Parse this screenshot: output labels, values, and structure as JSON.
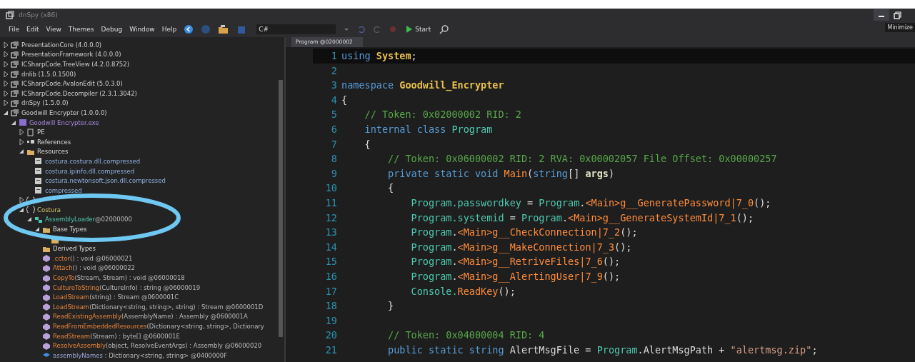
{
  "window": {
    "title": "dnSpy (x86)",
    "tooltip": "Minimize"
  },
  "menu": [
    {
      "label": "File"
    },
    {
      "label": "Edit"
    },
    {
      "label": "View"
    },
    {
      "label": "Themes"
    },
    {
      "label": "Debug"
    },
    {
      "label": "Window"
    },
    {
      "label": "Help"
    }
  ],
  "toolbar": {
    "language": "C#",
    "start": "Start"
  },
  "tree": [
    {
      "label": "PresentationCore (4.0.0.0)",
      "kind": "assembly",
      "expanded": false
    },
    {
      "label": "PresentationFramework (4.0.0.0)",
      "kind": "assembly",
      "expanded": false
    },
    {
      "label": "ICSharpCode.TreeView (4.2.0.8752)",
      "kind": "assembly",
      "expanded": false
    },
    {
      "label": "dnlib (1.5.0.1500)",
      "kind": "assembly",
      "expanded": false
    },
    {
      "label": "ICSharpCode.AvalonEdit (5.0.3.0)",
      "kind": "assembly",
      "expanded": false
    },
    {
      "label": "ICSharpCode.Decompiler (2.3.1.3042)",
      "kind": "assembly",
      "expanded": false
    },
    {
      "label": "dnSpy (1.5.0.0)",
      "kind": "assembly",
      "expanded": false
    },
    {
      "label": "Goodwill Encrypter (1.0.0.0)",
      "kind": "assembly",
      "expanded": true,
      "children": [
        {
          "label": "Goodwill Encrypter.exe",
          "kind": "module",
          "expanded": true,
          "children": [
            {
              "label": "PE",
              "kind": "pe",
              "expanded": false
            },
            {
              "label": "References",
              "kind": "references",
              "expanded": false
            },
            {
              "label": "Resources",
              "kind": "folder",
              "expanded": true,
              "children": [
                {
                  "label": "costura.costura.dll.compressed",
                  "kind": "resource"
                },
                {
                  "label": "costura.ipinfo.dll.compressed",
                  "kind": "resource"
                },
                {
                  "label": "costura.newtonsoft.json.dll.compressed",
                  "kind": "resource"
                },
                {
                  "label": "compressed",
                  "kind": "resource"
                }
              ]
            },
            {
              "kind": "namespace",
              "expanded": false
            },
            {
              "label": "Costura",
              "kind": "namespace",
              "expanded": true,
              "children": [
                {
                  "label": "AssemblyLoader",
                  "suffix": "@02000000",
                  "kind": "class",
                  "expanded": true,
                  "children": [
                    {
                      "label": "Base Types",
                      "kind": "folder",
                      "expanded": true,
                      "children": [
                        {
                          "kind": "folder"
                        }
                      ]
                    },
                    {
                      "label": "Derived Types",
                      "kind": "folder"
                    },
                    {
                      "label": ".cctor",
                      "suffix": "() : void @06000021",
                      "kind": "method"
                    },
                    {
                      "label": "Attach",
                      "suffix": "() : void @06000022",
                      "kind": "method"
                    },
                    {
                      "label": "CopyTo",
                      "suffix": "(Stream, Stream) : void @06000018",
                      "kind": "method"
                    },
                    {
                      "label": "CultureToString",
                      "suffix": "(CultureInfo) : string @06000019",
                      "kind": "method"
                    },
                    {
                      "label": "LoadStream",
                      "suffix": "(string) : Stream @0600001C",
                      "kind": "method"
                    },
                    {
                      "label": "LoadStream",
                      "suffix": "(Dictionary<string, string>, string) : Stream @0600001D",
                      "kind": "method"
                    },
                    {
                      "label": "ReadExistingAssembly",
                      "suffix": "(AssemblyName) : Assembly @0600001A",
                      "kind": "method"
                    },
                    {
                      "label": "ReadFromEmbeddedResources",
                      "suffix": "(Dictionary<string, string>, Dictionary",
                      "kind": "method"
                    },
                    {
                      "label": "ReadStream",
                      "suffix": "(Stream) : byte[] @0600001E",
                      "kind": "method"
                    },
                    {
                      "label": "ResolveAssembly",
                      "suffix": "(object, ResolveEventArgs) : Assembly @06000020",
                      "kind": "method"
                    },
                    {
                      "label": "assemblyNames",
                      "suffix": " : Dictionary<string, string> @0400000F",
                      "kind": "field"
                    }
                  ]
                }
              ]
            }
          ]
        }
      ]
    }
  ],
  "editor": {
    "tab": "Program @02000002",
    "lines": [
      {
        "num": "1",
        "current": true,
        "tokens": [
          {
            "kind": "kw",
            "text": "using "
          },
          {
            "kind": "ns",
            "text": "System"
          },
          {
            "kind": "p",
            "text": ";"
          }
        ]
      },
      {
        "num": "2",
        "current": false
      },
      {
        "num": "3",
        "current": false,
        "tokens": [
          {
            "kind": "kw",
            "text": "namespace "
          },
          {
            "kind": "ns",
            "text": "Goodwill_Encrypter"
          }
        ]
      },
      {
        "num": "4",
        "current": false,
        "tokens": [
          {
            "kind": "p",
            "text": "{"
          }
        ],
        "children": [
          {
            "num": "5",
            "current": false,
            "tokens": [
              {
                "kind": "c",
                "text": "// Token: 0x02000002 RID: 2"
              }
            ]
          },
          {
            "num": "6",
            "current": false,
            "tokens": [
              {
                "kind": "kw",
                "text": "internal class "
              },
              {
                "kind": "type",
                "text": "Program"
              }
            ]
          },
          {
            "num": "7",
            "current": false,
            "tokens": [
              {
                "kind": "p",
                "text": "{"
              }
            ],
            "children": [
              {
                "num": "8",
                "current": false,
                "tokens": [
                  {
                    "kind": "c",
                    "text": "// Token: 0x06000002 RID: 2 RVA: 0x00002057 File Offset: 0x00000257"
                  }
                ]
              },
              {
                "num": "9",
                "current": false,
                "tokens": [
                  {
                    "kind": "kw",
                    "text": "private static void "
                  },
                  {
                    "kind": "m",
                    "text": "Main"
                  },
                  {
                    "kind": "p",
                    "text": "("
                  },
                  {
                    "kind": "kw",
                    "text": "string"
                  },
                  {
                    "kind": "p",
                    "text": "[] "
                  },
                  {
                    "kind": "arg",
                    "text": "args"
                  },
                  {
                    "kind": "p",
                    "text": ")"
                  }
                ]
              },
              {
                "num": "10",
                "current": false,
                "tokens": [
                  {
                    "kind": "p",
                    "text": "{"
                  }
                ],
                "children": [
                  {
                    "num": "11",
                    "current": false,
                    "tokens": [
                      {
                        "kind": "type",
                        "text": "Program.passwordkey"
                      },
                      {
                        "kind": "p",
                        "text": " = "
                      },
                      {
                        "kind": "type",
                        "text": "Program"
                      },
                      {
                        "kind": "p",
                        "text": "."
                      },
                      {
                        "kind": "m",
                        "text": "<Main>g__GeneratePassword|7_0"
                      },
                      {
                        "kind": "p",
                        "text": "();"
                      }
                    ]
                  },
                  {
                    "num": "12",
                    "current": false,
                    "tokens": [
                      {
                        "kind": "type",
                        "text": "Program.systemid"
                      },
                      {
                        "kind": "p",
                        "text": " = "
                      },
                      {
                        "kind": "type",
                        "text": "Program"
                      },
                      {
                        "kind": "p",
                        "text": "."
                      },
                      {
                        "kind": "m",
                        "text": "<Main>g__GenerateSystemId|7_1"
                      },
                      {
                        "kind": "p",
                        "text": "();"
                      }
                    ]
                  },
                  {
                    "num": "13",
                    "current": false,
                    "tokens": [
                      {
                        "kind": "type",
                        "text": "Program"
                      },
                      {
                        "kind": "p",
                        "text": "."
                      },
                      {
                        "kind": "m",
                        "text": "<Main>g__CheckConnection|7_2"
                      },
                      {
                        "kind": "p",
                        "text": "();"
                      }
                    ]
                  },
                  {
                    "num": "14",
                    "current": false,
                    "tokens": [
                      {
                        "kind": "type",
                        "text": "Program"
                      },
                      {
                        "kind": "p",
                        "text": "."
                      },
                      {
                        "kind": "m",
                        "text": "<Main>g__MakeConnection|7_3"
                      },
                      {
                        "kind": "p",
                        "text": "();"
                      }
                    ]
                  },
                  {
                    "num": "15",
                    "current": false,
                    "tokens": [
                      {
                        "kind": "type",
                        "text": "Program"
                      },
                      {
                        "kind": "p",
                        "text": "."
                      },
                      {
                        "kind": "m",
                        "text": "<Main>g__RetriveFiles|7_6"
                      },
                      {
                        "kind": "p",
                        "text": "();"
                      }
                    ]
                  },
                  {
                    "num": "16",
                    "current": false,
                    "tokens": [
                      {
                        "kind": "type",
                        "text": "Program"
                      },
                      {
                        "kind": "p",
                        "text": "."
                      },
                      {
                        "kind": "m",
                        "text": "<Main>g__AlertingUser|7_9"
                      },
                      {
                        "kind": "p",
                        "text": "();"
                      }
                    ]
                  },
                  {
                    "num": "17",
                    "current": false,
                    "tokens": [
                      {
                        "kind": "type",
                        "text": "Console."
                      },
                      {
                        "kind": "m",
                        "text": "ReadKey"
                      },
                      {
                        "kind": "p",
                        "text": "();"
                      }
                    ]
                  }
                ]
              },
              {
                "num": "18",
                "current": false,
                "tokens": [
                  {
                    "kind": "p",
                    "text": "}"
                  }
                ]
              },
              {
                "num": "19",
                "current": false
              },
              {
                "num": "20",
                "current": false,
                "tokens": [
                  {
                    "kind": "c",
                    "text": "// Token: 0x04000004 RID: 4"
                  }
                ]
              },
              {
                "num": "21",
                "current": false,
                "tokens": [
                  {
                    "kind": "kw",
                    "text": "public static string "
                  },
                  {
                    "kind": "p",
                    "text": "AlertMsgFile = "
                  },
                  {
                    "kind": "type",
                    "text": "Program"
                  },
                  {
                    "kind": "p",
                    "text": ".AlertMsgPath + "
                  },
                  {
                    "kind": "s",
                    "text": "\"alertmsg.zip\""
                  },
                  {
                    "kind": "p",
                    "text": ";"
                  }
                ]
              }
            ]
          }
        ]
      }
    ]
  }
}
